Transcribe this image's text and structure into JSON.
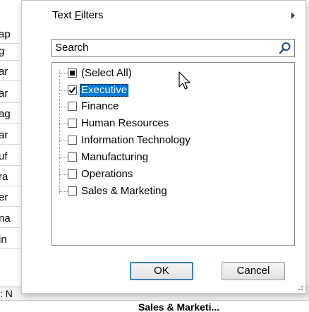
{
  "sheet": {
    "cells": [
      "ap",
      "g",
      "ar",
      "ar",
      "ag",
      "ar",
      "uf",
      "ra",
      "er",
      "na",
      "in"
    ],
    "header_fragment": ": N",
    "cell_below": "Sales & Marketi..."
  },
  "menu": {
    "text_filters_label": "Text Filters",
    "text_filters_mnemonic": "F"
  },
  "search": {
    "placeholder": "Search"
  },
  "filter_list": {
    "items": [
      {
        "label": "(Select All)",
        "state": "partial",
        "selected": false
      },
      {
        "label": "Executive",
        "state": "checked",
        "selected": true
      },
      {
        "label": "Finance",
        "state": "unchecked",
        "selected": false
      },
      {
        "label": "Human Resources",
        "state": "unchecked",
        "selected": false
      },
      {
        "label": "Information Technology",
        "state": "unchecked",
        "selected": false
      },
      {
        "label": "Manufacturing",
        "state": "unchecked",
        "selected": false
      },
      {
        "label": "Operations",
        "state": "unchecked",
        "selected": false
      },
      {
        "label": "Sales & Marketing",
        "state": "unchecked",
        "selected": false
      }
    ]
  },
  "buttons": {
    "ok_label": "OK",
    "cancel_label": "Cancel"
  },
  "icons": {
    "search": "search-icon",
    "submenu": "chevron-right-icon",
    "resize": "resize-grip-icon",
    "cursor": "mouse-pointer-icon"
  },
  "colors": {
    "selection": "#0078d7",
    "ok_border": "#3c7fb1"
  }
}
